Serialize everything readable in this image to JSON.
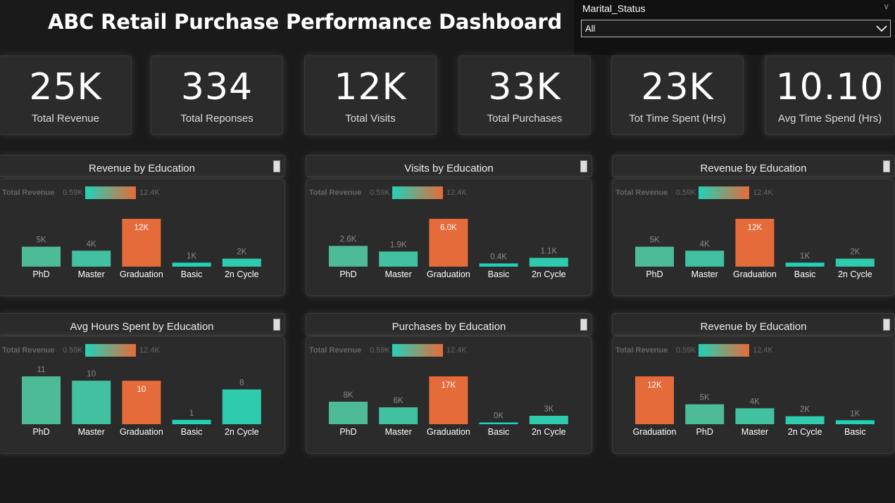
{
  "title": "ABC Retail Purchase Performance Dashboard",
  "slicer": {
    "label": "Marital_Status",
    "value": "All"
  },
  "kpis": [
    {
      "value": "25K",
      "label": "Total Revenue"
    },
    {
      "value": "334",
      "label": "Total Reponses"
    },
    {
      "value": "12K",
      "label": "Total Visits"
    },
    {
      "value": "33K",
      "label": "Total Purchases"
    },
    {
      "value": "23K",
      "label": "Tot Time Spent (Hrs)"
    },
    {
      "value": "10.10",
      "label": "Avg Time Spend (Hrs)"
    }
  ],
  "legend": {
    "title": "Total Revenue",
    "min": "0.59K",
    "max": "12.4K"
  },
  "colors": {
    "min": "#21d2b8",
    "max": "#e56b3a"
  },
  "chart_data": [
    {
      "type": "bar",
      "title": "Revenue by Education",
      "categories": [
        "PhD",
        "Master",
        "Graduation",
        "Basic",
        "2n Cycle"
      ],
      "values": [
        5,
        4,
        12,
        1,
        2
      ],
      "labels": [
        "5K",
        "4K",
        "12K",
        "1K",
        "2K"
      ],
      "color_values": [
        5.3,
        4.0,
        12.4,
        0.59,
        2.0
      ],
      "ylim": [
        0,
        12
      ]
    },
    {
      "type": "bar",
      "title": "Visits by Education",
      "categories": [
        "PhD",
        "Master",
        "Graduation",
        "Basic",
        "2n Cycle"
      ],
      "values": [
        2.6,
        1.9,
        6.0,
        0.4,
        1.1
      ],
      "labels": [
        "2.6K",
        "1.9K",
        "6.0K",
        "0.4K",
        "1.1K"
      ],
      "color_values": [
        5.3,
        4.0,
        12.4,
        0.59,
        2.0
      ],
      "ylim": [
        0,
        6
      ]
    },
    {
      "type": "bar",
      "title": "Revenue by Education",
      "categories": [
        "PhD",
        "Master",
        "Graduation",
        "Basic",
        "2n Cycle"
      ],
      "values": [
        5,
        4,
        12,
        1,
        2
      ],
      "labels": [
        "5K",
        "4K",
        "12K",
        "1K",
        "2K"
      ],
      "color_values": [
        5.3,
        4.0,
        12.4,
        0.59,
        2.0
      ],
      "ylim": [
        0,
        12
      ]
    },
    {
      "type": "bar",
      "title": "Avg Hours Spent by Education",
      "categories": [
        "PhD",
        "Master",
        "Graduation",
        "Basic",
        "2n Cycle"
      ],
      "values": [
        11,
        10,
        10,
        1,
        8
      ],
      "labels": [
        "11",
        "10",
        "10",
        "1",
        "8"
      ],
      "color_values": [
        5.3,
        4.0,
        12.4,
        0.59,
        2.0
      ],
      "ylim": [
        0,
        11
      ]
    },
    {
      "type": "bar",
      "title": "Purchases by Education",
      "categories": [
        "PhD",
        "Master",
        "Graduation",
        "Basic",
        "2n Cycle"
      ],
      "values": [
        8,
        6,
        17,
        0.2,
        3
      ],
      "labels": [
        "8K",
        "6K",
        "17K",
        "0K",
        "3K"
      ],
      "color_values": [
        5.3,
        4.0,
        12.4,
        0.59,
        2.0
      ],
      "ylim": [
        0,
        17
      ]
    },
    {
      "type": "bar",
      "title": "Revenue by Education",
      "categories": [
        "Graduation",
        "PhD",
        "Master",
        "2n Cycle",
        "Basic"
      ],
      "values": [
        12,
        5,
        4,
        2,
        1
      ],
      "labels": [
        "12K",
        "5K",
        "4K",
        "2K",
        "1K"
      ],
      "color_values": [
        12.4,
        5.3,
        4.0,
        2.0,
        0.59
      ],
      "ylim": [
        0,
        12
      ]
    }
  ]
}
